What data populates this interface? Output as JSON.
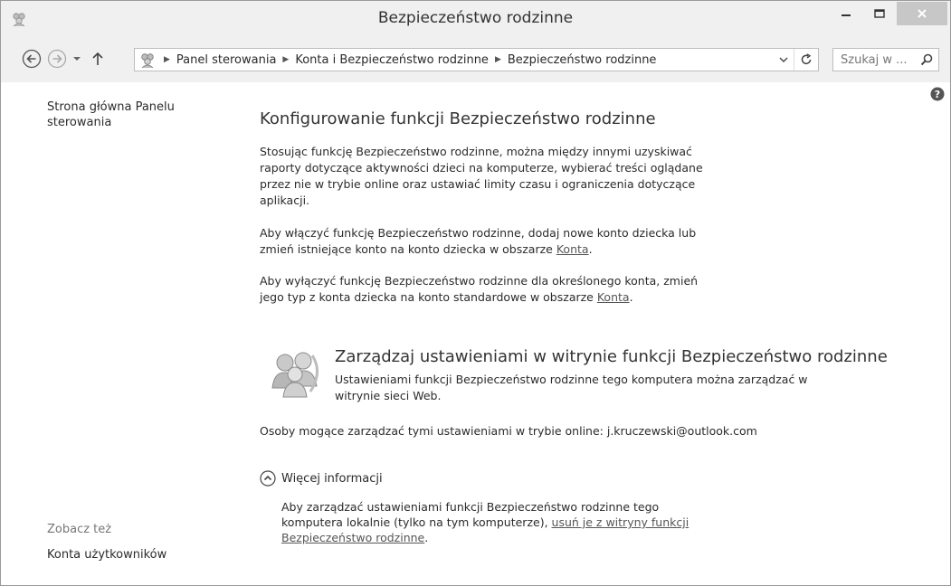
{
  "window": {
    "title": "Bezpieczeństwo rodzinne"
  },
  "nav": {
    "breadcrumbs": [
      "Panel sterowania",
      "Konta i Bezpieczeństwo rodzinne",
      "Bezpieczeństwo rodzinne"
    ],
    "search_placeholder": "Szukaj w ..."
  },
  "sidebar": {
    "home_link": "Strona główna Panelu sterowania",
    "see_also_label": "Zobacz też",
    "see_also_items": [
      "Konta użytkowników"
    ]
  },
  "main": {
    "heading": "Konfigurowanie funkcji Bezpieczeństwo rodzinne",
    "intro": "Stosując funkcję Bezpieczeństwo rodzinne, można między innymi uzyskiwać raporty dotyczące aktywności dzieci na komputerze, wybierać treści oglądane przez nie w trybie online oraz ustawiać limity czasu i ograniczenia dotyczące aplikacji.",
    "enable_text": "Aby włączyć funkcję Bezpieczeństwo rodzinne, dodaj nowe konto dziecka lub zmień istniejące konto na konto dziecka w obszarze",
    "enable_link": "Konta",
    "disable_text": "Aby wyłączyć funkcję Bezpieczeństwo rodzinne dla określonego konta, zmień jego typ z konta dziecka na konto standardowe w obszarze",
    "disable_link": "Konta",
    "punct": "."
  },
  "manage": {
    "title": "Zarządzaj ustawieniami w witrynie funkcji Bezpieczeństwo rodzinne",
    "description": "Ustawieniami funkcji Bezpieczeństwo rodzinne tego komputera można zarządzać w witrynie sieci Web.",
    "persons_label": "Osoby mogące zarządzać tymi ustawieniami w trybie online:",
    "persons_value": "j.kruczewski@outlook.com"
  },
  "more_info": {
    "label": "Więcej informacji",
    "text": "Aby zarządzać ustawieniami funkcji Bezpieczeństwo rodzinne tego komputera lokalnie (tylko na tym komputerze),",
    "link": "usuń je z witryny funkcji Bezpieczeństwo rodzinne",
    "punct": "."
  },
  "icons": {
    "app": "family-safety-icon",
    "back": "back-arrow-icon",
    "forward": "forward-arrow-icon",
    "recent": "chevron-down-icon",
    "up": "up-arrow-icon",
    "refresh": "refresh-icon",
    "search": "search-icon",
    "help": "help-icon",
    "manage": "users-group-icon",
    "expand": "chevron-up-circle-icon"
  },
  "colors": {
    "close_button": "#c7c7c7",
    "chrome": "#f0f0f0",
    "link": "#555555"
  }
}
